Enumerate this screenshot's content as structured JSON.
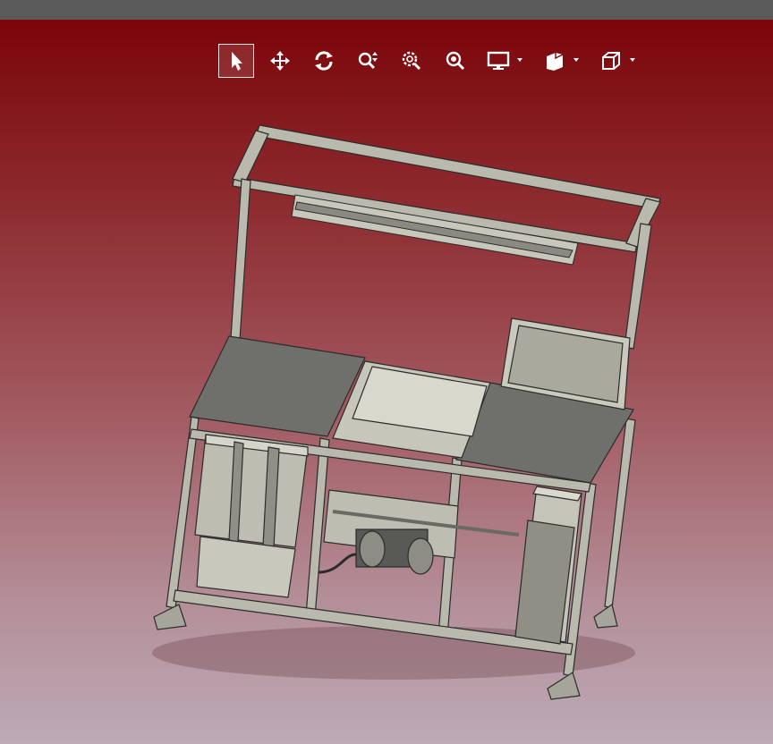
{
  "toolbar": {
    "buttons": [
      {
        "id": "select",
        "icon": "cursor-arrow-icon",
        "active": true
      },
      {
        "id": "pan",
        "icon": "move-arrows-icon"
      },
      {
        "id": "rotate",
        "icon": "rotate-icon"
      },
      {
        "id": "zoom-vertical",
        "icon": "zoom-vertical-icon"
      },
      {
        "id": "zoom-window",
        "icon": "zoom-window-icon"
      },
      {
        "id": "zoom-fit",
        "icon": "zoom-fit-icon"
      },
      {
        "id": "display-mode",
        "icon": "monitor-icon",
        "dropdown": true
      },
      {
        "id": "view-style",
        "icon": "shaded-box-icon",
        "dropdown": true
      },
      {
        "id": "view-orientation",
        "icon": "wireframe-cube-icon",
        "dropdown": true
      }
    ]
  },
  "colors": {
    "background_top": "#7b0509",
    "background_bottom": "#bcaab6",
    "model_fill": "#b9b9ad",
    "model_dark": "#6f6f6b",
    "model_edge": "#2b2b2b"
  }
}
